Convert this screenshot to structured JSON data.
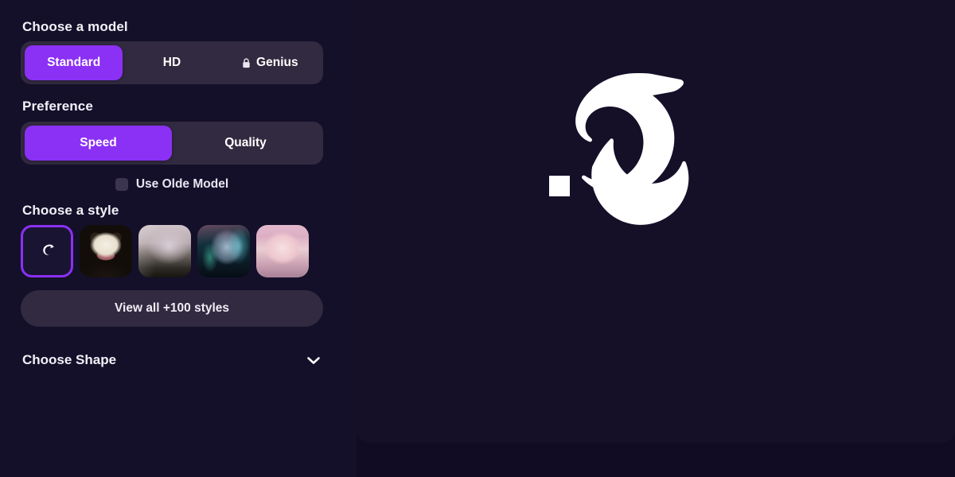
{
  "theme": {
    "page_bg": "#110c24",
    "sidebar_bg": "#14102a",
    "canvas_bg": "#150f28",
    "accent": "#8b30f5",
    "track_bg": "#322a40",
    "pill_bg": "#312a40",
    "text": "#f2f0f7",
    "logo_color": "#ffffff"
  },
  "sidebar": {
    "model_section": {
      "label": "Choose a model",
      "options": [
        {
          "label": "Standard",
          "selected": true,
          "locked": false
        },
        {
          "label": "HD",
          "selected": false,
          "locked": false
        },
        {
          "label": "Genius",
          "selected": false,
          "locked": true
        }
      ]
    },
    "preference_section": {
      "label": "Preference",
      "options": [
        {
          "label": "Speed",
          "selected": true
        },
        {
          "label": "Quality",
          "selected": false
        }
      ],
      "checkbox": {
        "label": "Use Olde Model",
        "checked": false
      }
    },
    "style_section": {
      "label": "Choose a style",
      "thumbnails": [
        {
          "name": "no-style",
          "selected": true,
          "kind": "dolphin-logo"
        },
        {
          "name": "panda",
          "selected": false,
          "kind": "image"
        },
        {
          "name": "forest",
          "selected": false,
          "kind": "image"
        },
        {
          "name": "cyberpunk",
          "selected": false,
          "kind": "image"
        },
        {
          "name": "anime-portrait",
          "selected": false,
          "kind": "image"
        }
      ],
      "view_all_label": "View all +100 styles"
    },
    "shape_section": {
      "label": "Choose Shape",
      "icon": "chevron-down-icon",
      "expanded": false
    }
  },
  "canvas": {
    "logo_alt": "dolphin-logo",
    "placeholder_square": true
  }
}
